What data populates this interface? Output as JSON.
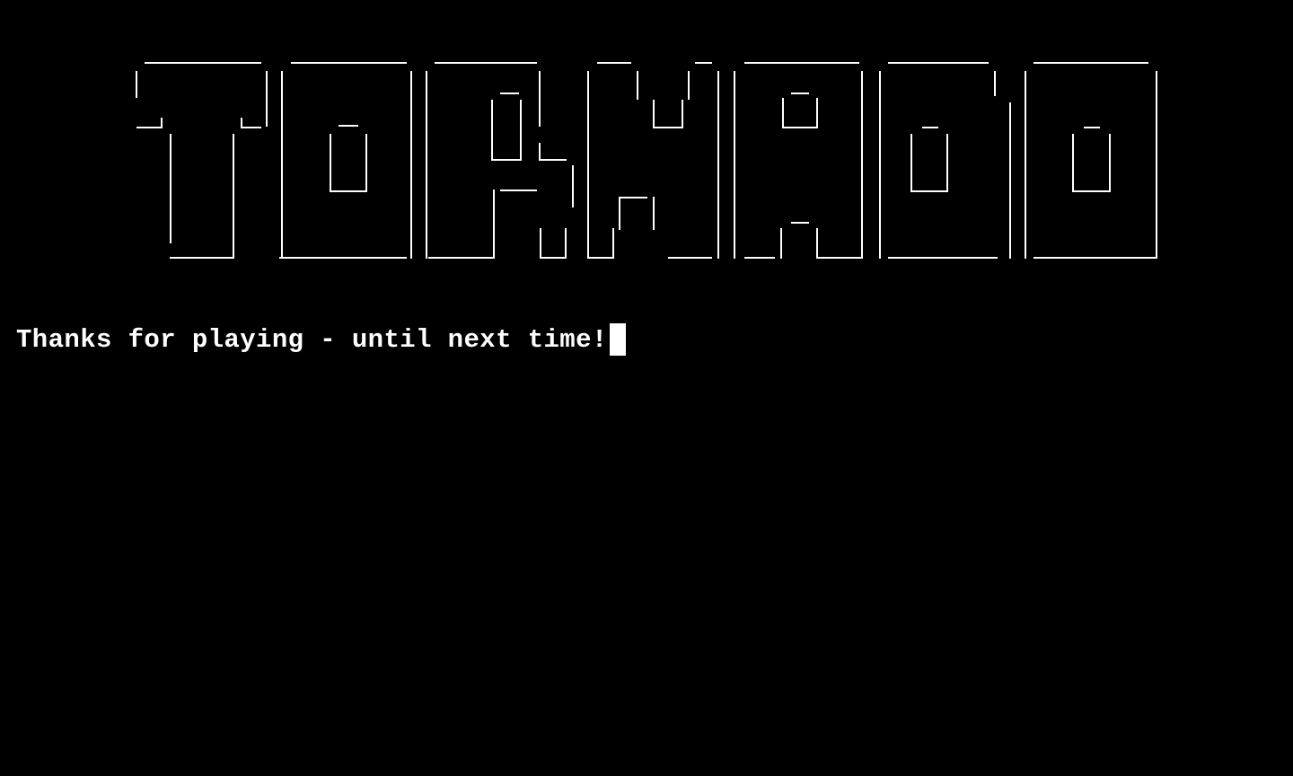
{
  "banner": {
    "text": "TORNADO"
  },
  "terminal": {
    "message": "Thanks for playing - until next time!"
  },
  "colors": {
    "background": "#000000",
    "foreground": "#ffffff"
  }
}
